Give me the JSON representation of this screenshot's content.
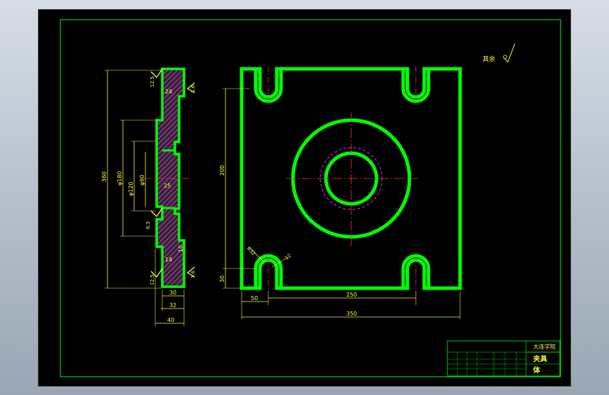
{
  "drawing": {
    "surface_note": "其余",
    "side_view": {
      "dims": {
        "overall_height": "360",
        "d180": "φ180",
        "d120": "φ120",
        "d90": "φ90",
        "h25": "25",
        "w30": "30",
        "w32": "32",
        "w40": "40",
        "t14": "14",
        "t24": "24",
        "t10": "10"
      },
      "roughness": {
        "top": "12.5",
        "bottom": "12.5",
        "middle": "6.3",
        "top_right": "1.6",
        "bottom_right": "1.6"
      }
    },
    "front_view": {
      "dims": {
        "height_200": "200",
        "offset_30": "30",
        "offset_50": "50",
        "span_250": "250",
        "width_350": "350",
        "slot_r": "R32",
        "slot_w": "12"
      }
    },
    "title_block": {
      "school": "大连学院",
      "part_name": "夹具",
      "part_sub": "体"
    }
  },
  "colors": {
    "outline": "#00ff00",
    "dimension": "#ffff33",
    "centerline": "#ff3333",
    "hidden": "#ff33ff",
    "frame": "#00ff00",
    "hatch": "#cc66cc"
  }
}
